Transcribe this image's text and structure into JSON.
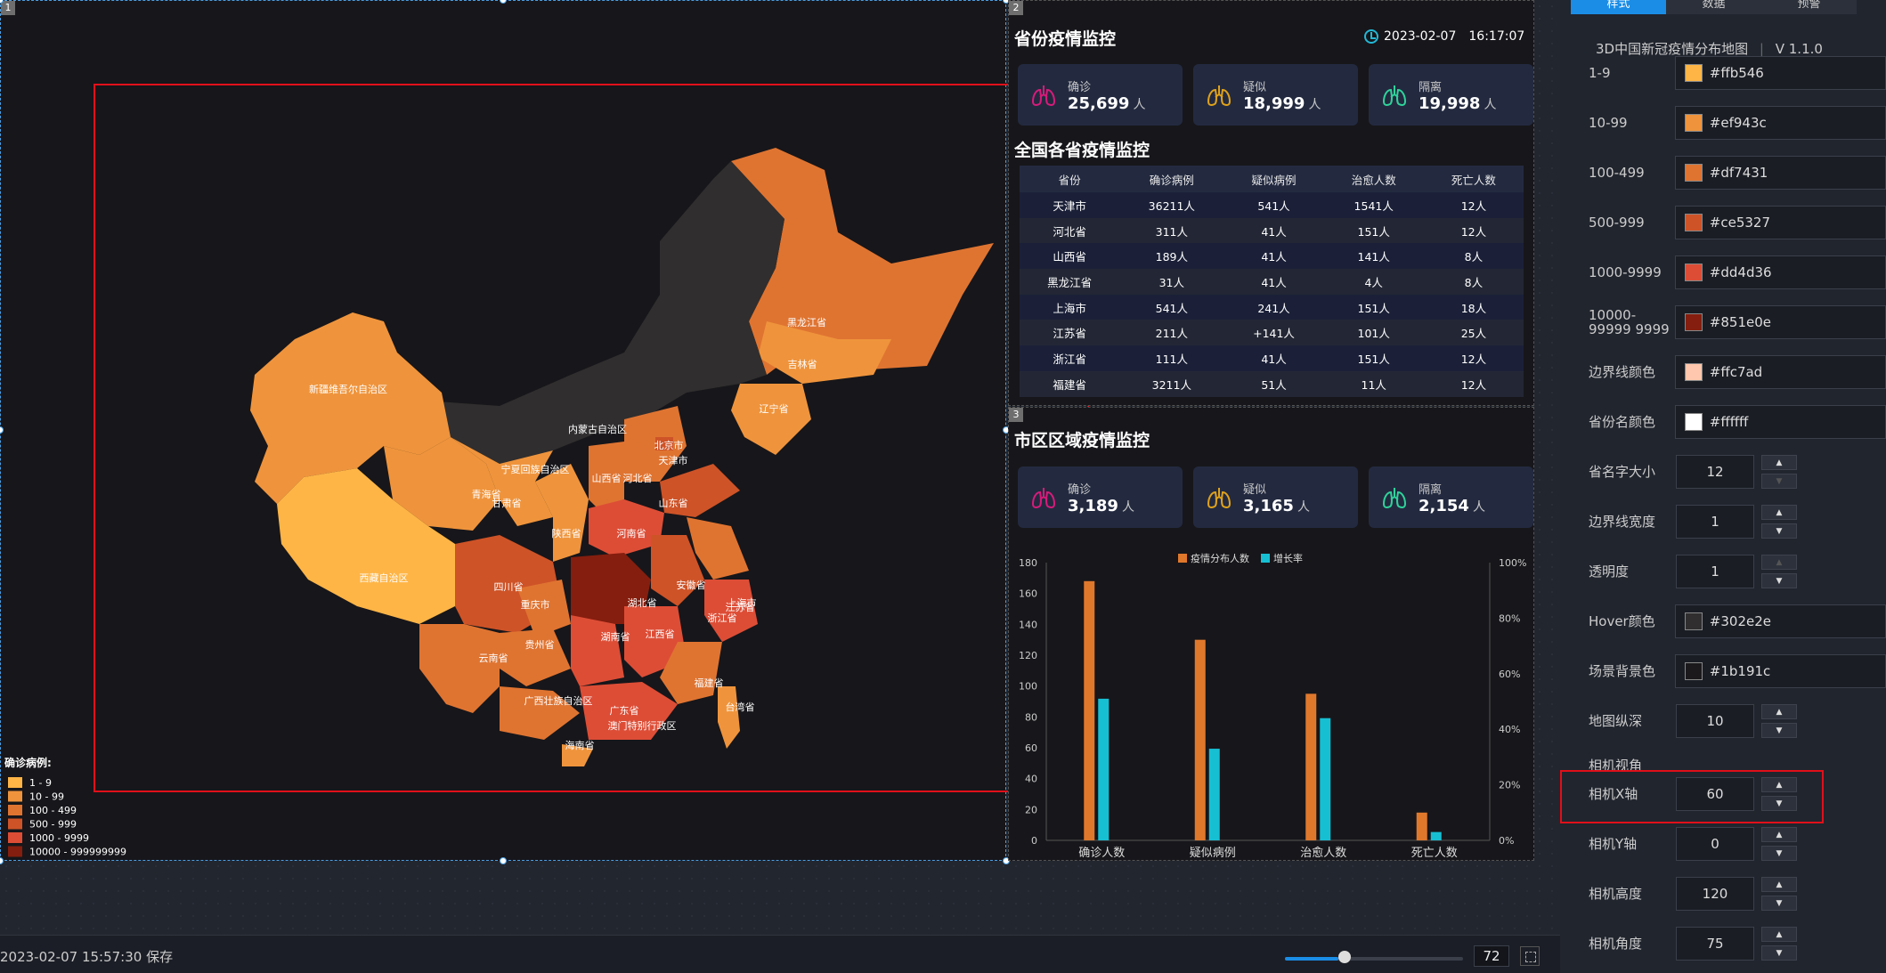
{
  "map_panel": {
    "panel_number": "1",
    "legend": {
      "title": "确诊病例:",
      "items": [
        {
          "label": "1 - 9",
          "color": "#ffb546"
        },
        {
          "label": "10 - 99",
          "color": "#ef943c"
        },
        {
          "label": "100 - 499",
          "color": "#df7431"
        },
        {
          "label": "500 - 999",
          "color": "#ce5327"
        },
        {
          "label": "1000 - 9999",
          "color": "#dd4d36"
        },
        {
          "label": "10000 - 999999999",
          "color": "#851e0e"
        }
      ]
    },
    "province_labels": [
      {
        "name": "黑龙江省",
        "level": 2
      },
      {
        "name": "吉林省",
        "level": 1
      },
      {
        "name": "辽宁省",
        "level": 1
      },
      {
        "name": "内蒙古自治区",
        "level": -1
      },
      {
        "name": "北京市",
        "level": 3
      },
      {
        "name": "天津市",
        "level": 4
      },
      {
        "name": "河北省",
        "level": 2
      },
      {
        "name": "山西省",
        "level": 2
      },
      {
        "name": "山东省",
        "level": 3
      },
      {
        "name": "宁夏回族自治区",
        "level": -1
      },
      {
        "name": "甘肃省",
        "level": 1
      },
      {
        "name": "青海省",
        "level": 1
      },
      {
        "name": "陕西省",
        "level": 2
      },
      {
        "name": "河南省",
        "level": 4
      },
      {
        "name": "新疆维吾尔自治区",
        "level": 1
      },
      {
        "name": "西藏自治区",
        "level": 0
      },
      {
        "name": "四川省",
        "level": 3
      },
      {
        "name": "重庆市",
        "level": 2
      },
      {
        "name": "湖北省",
        "level": 5
      },
      {
        "name": "安徽省",
        "level": 3
      },
      {
        "name": "江苏省",
        "level": 3
      },
      {
        "name": "上海市",
        "level": 4
      },
      {
        "name": "浙江省",
        "level": 4
      },
      {
        "name": "湖南省",
        "level": 4
      },
      {
        "name": "江西省",
        "level": 4
      },
      {
        "name": "贵州省",
        "level": 2
      },
      {
        "name": "云南省",
        "level": 1
      },
      {
        "name": "福建省",
        "level": 2
      },
      {
        "name": "台湾省",
        "level": 1
      },
      {
        "name": "广西壮族自治区",
        "level": 2
      },
      {
        "name": "广东省",
        "level": 4
      },
      {
        "name": "海南省",
        "level": 2
      },
      {
        "name": "澳门特别行政区",
        "level": 4
      }
    ]
  },
  "province_panel": {
    "panel_number": "2",
    "title": "省份疫情监控",
    "date": "2023-02-07",
    "time": "16:17:07",
    "cards": [
      {
        "label": "确诊",
        "value": "25,699",
        "unit": "人",
        "color": "#d81b7a"
      },
      {
        "label": "疑似",
        "value": "18,999",
        "unit": "人",
        "color": "#e0a21a"
      },
      {
        "label": "隔离",
        "value": "19,998",
        "unit": "人",
        "color": "#2fd39a"
      }
    ],
    "table_title": "全国各省疫情监控",
    "table": {
      "headers": [
        "省份",
        "确诊病例",
        "疑似病例",
        "治愈人数",
        "死亡人数"
      ],
      "rows": [
        [
          "天津市",
          "36211人",
          "541人",
          "1541人",
          "12人"
        ],
        [
          "河北省",
          "311人",
          "41人",
          "151人",
          "12人"
        ],
        [
          "山西省",
          "189人",
          "41人",
          "141人",
          "8人"
        ],
        [
          "黑龙江省",
          "31人",
          "41人",
          "4人",
          "8人"
        ],
        [
          "上海市",
          "541人",
          "241人",
          "151人",
          "18人"
        ],
        [
          "江苏省",
          "211人",
          "+141人",
          "101人",
          "25人"
        ],
        [
          "浙江省",
          "111人",
          "41人",
          "151人",
          "12人"
        ],
        [
          "福建省",
          "3211人",
          "51人",
          "11人",
          "12人"
        ]
      ]
    }
  },
  "city_panel": {
    "panel_number": "3",
    "title": "市区区域疫情监控",
    "cards": [
      {
        "label": "确诊",
        "value": "3,189",
        "unit": "人",
        "color": "#d81b7a"
      },
      {
        "label": "疑似",
        "value": "3,165",
        "unit": "人",
        "color": "#e0a21a"
      },
      {
        "label": "隔离",
        "value": "2,154",
        "unit": "人",
        "color": "#2fd39a"
      }
    ]
  },
  "chart_data": {
    "type": "bar",
    "categories": [
      "确诊人数",
      "疑似病例",
      "治愈人数",
      "死亡人数"
    ],
    "series": [
      {
        "name": "疫情分布人数",
        "color": "#e0782c",
        "axis": "left",
        "values": [
          168,
          130,
          95,
          18
        ]
      },
      {
        "name": "增长率",
        "color": "#17bfd3",
        "axis": "right",
        "values": [
          51,
          33,
          44,
          3
        ]
      }
    ],
    "y_left": {
      "min": 0,
      "max": 180,
      "ticks": [
        "0",
        "20",
        "40",
        "60",
        "80",
        "100",
        "120",
        "140",
        "160",
        "180"
      ]
    },
    "y_right": {
      "min": 0,
      "max": 100,
      "ticks": [
        "0%",
        "20%",
        "40%",
        "60%",
        "80%",
        "100%"
      ]
    },
    "legend_position": "top-center",
    "grid": false
  },
  "config": {
    "tabs": [
      "样式",
      "数据",
      "预警"
    ],
    "app_name": "3D中国新冠疫情分布地图",
    "version": "V 1.1.0",
    "color_ranges": [
      {
        "label": "1-9",
        "value": "#ffb546"
      },
      {
        "label": "10-99",
        "value": "#ef943c"
      },
      {
        "label": "100-499",
        "value": "#df7431"
      },
      {
        "label": "500-999",
        "value": "#ce5327"
      },
      {
        "label": "1000-9999",
        "value": "#dd4d36"
      },
      {
        "label": "10000-99999 9999",
        "value": "#851e0e"
      },
      {
        "label": "边界线颜色",
        "value": "#ffc7ad"
      },
      {
        "label": "省份名颜色",
        "value": "#ffffff"
      }
    ],
    "numbers_a": [
      {
        "label": "省名字大小",
        "value": "12"
      },
      {
        "label": "边界线宽度",
        "value": "1"
      },
      {
        "label": "透明度",
        "value": "1"
      }
    ],
    "hover_color": {
      "label": "Hover颜色",
      "value": "#302e2e"
    },
    "bg_color": {
      "label": "场景背景色",
      "value": "#1b191c"
    },
    "map_depth": {
      "label": "地图纵深",
      "value": "10"
    },
    "camera_section": "相机视角",
    "camera": [
      {
        "label": "相机X轴",
        "value": "60"
      },
      {
        "label": "相机Y轴",
        "value": "0"
      },
      {
        "label": "相机高度",
        "value": "120"
      },
      {
        "label": "相机角度",
        "value": "75"
      }
    ]
  },
  "bottom_bar": {
    "save_status": "2023-02-07 15:57:30 保存",
    "zoom": "72",
    "zoom_fraction": 0.3
  }
}
